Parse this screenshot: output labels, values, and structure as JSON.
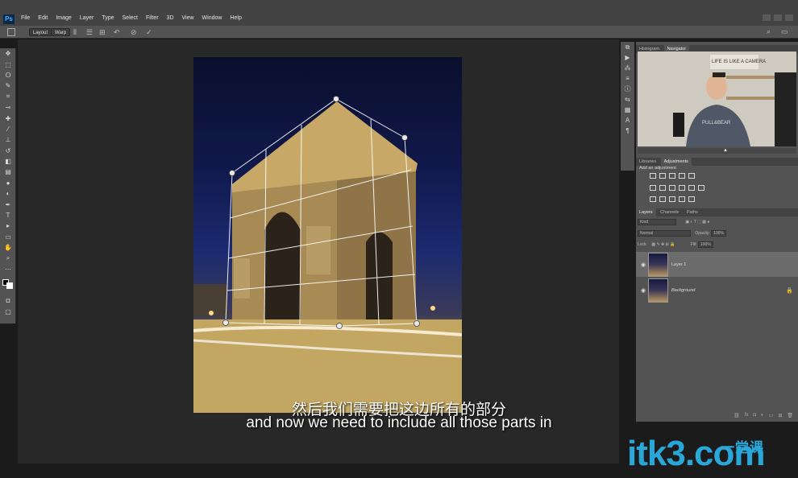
{
  "app": {
    "logo": "Ps",
    "menus": [
      "File",
      "Edit",
      "Image",
      "Layer",
      "Type",
      "Select",
      "Filter",
      "3D",
      "View",
      "Window",
      "Help"
    ]
  },
  "options_bar": {
    "layout_label": "Layout",
    "warp_label": "Warp"
  },
  "panels": {
    "top_tabs": [
      "Histogram",
      "Navigator"
    ],
    "mid_tabs": [
      "Libraries",
      "Adjustments"
    ],
    "add_adjustment": "Add an adjustment",
    "layer_tabs": [
      "Layers",
      "Channels",
      "Paths"
    ],
    "kind_placeholder": "Kind",
    "blend_mode": "Normal",
    "opacity_label": "Opacity:",
    "opacity_value": "100%",
    "lock_label": "Lock:",
    "fill_label": "Fill:",
    "fill_value": "100%",
    "layers": [
      "Layer 1",
      "Background"
    ],
    "navigator_shirt": "PULL&BEAR",
    "navigator_sign": "LIFE IS LIKE A CAMERA"
  },
  "subtitles": {
    "chinese": "然后我们需要把这边所有的部分",
    "english": "and now we need to include all those parts in"
  },
  "watermark": {
    "text": "itk3.com",
    "chinese": "一堂课"
  },
  "colors": {
    "accent": "#2aa7d9",
    "panel": "#535353",
    "canvas": "#282828"
  }
}
